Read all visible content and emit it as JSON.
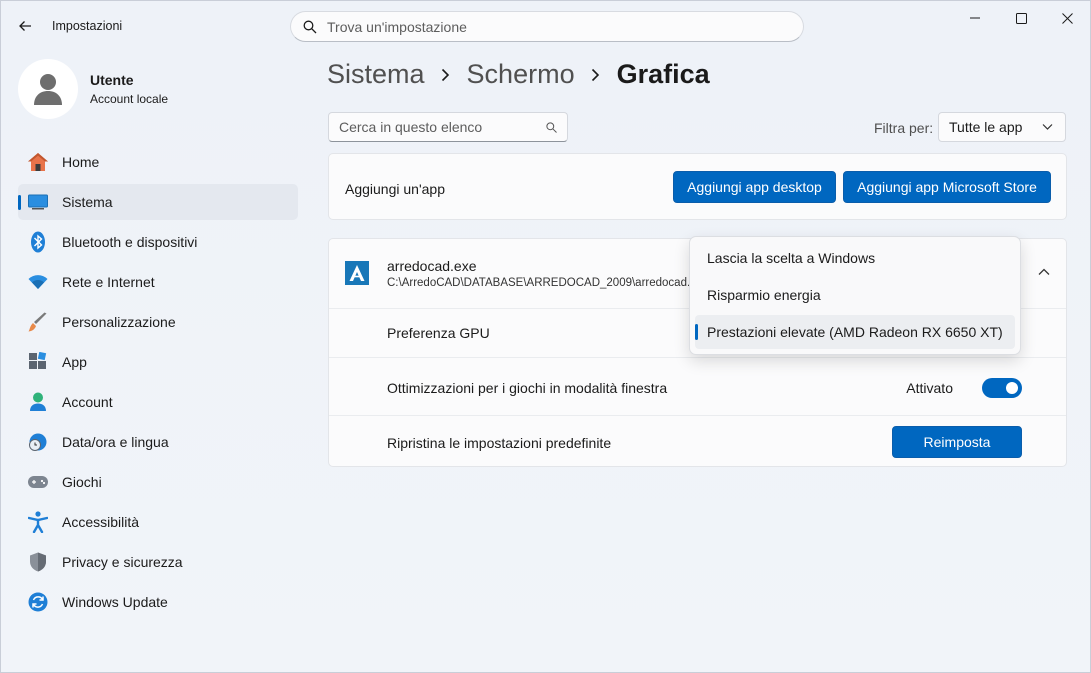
{
  "window": {
    "app_title": "Impostazioni",
    "search_placeholder": "Trova un'impostazione"
  },
  "profile": {
    "name": "Utente",
    "account_type": "Account locale"
  },
  "sidebar": {
    "items": [
      {
        "label": "Home",
        "icon": "home-icon"
      },
      {
        "label": "Sistema",
        "icon": "system-icon",
        "active": true
      },
      {
        "label": "Bluetooth e dispositivi",
        "icon": "bluetooth-icon"
      },
      {
        "label": "Rete e Internet",
        "icon": "wifi-icon"
      },
      {
        "label": "Personalizzazione",
        "icon": "brush-icon"
      },
      {
        "label": "App",
        "icon": "apps-icon"
      },
      {
        "label": "Account",
        "icon": "account-icon"
      },
      {
        "label": "Data/ora e lingua",
        "icon": "clock-globe-icon"
      },
      {
        "label": "Giochi",
        "icon": "gamepad-icon"
      },
      {
        "label": "Accessibilità",
        "icon": "accessibility-icon"
      },
      {
        "label": "Privacy e sicurezza",
        "icon": "shield-icon"
      },
      {
        "label": "Windows Update",
        "icon": "update-icon"
      }
    ]
  },
  "breadcrumb": {
    "items": [
      "Sistema",
      "Schermo",
      "Grafica"
    ]
  },
  "list_controls": {
    "search_placeholder": "Cerca in questo elenco",
    "filter_label": "Filtra per:",
    "filter_value": "Tutte le app"
  },
  "add_app": {
    "label": "Aggiungi un'app",
    "desktop_button": "Aggiungi app desktop",
    "store_button": "Aggiungi app Microsoft Store"
  },
  "app_entry": {
    "name": "arredocad.exe",
    "path": "C:\\ArredoCAD\\DATABASE\\ARREDOCAD_2009\\arredocad.exe",
    "gpu_pref_label": "Preferenza GPU",
    "windowed_opt_label": "Ottimizzazioni per i giochi in modalità finestra",
    "windowed_opt_state": "Attivato",
    "reset_label": "Ripristina le impostazioni predefinite",
    "reset_button": "Reimposta"
  },
  "gpu_dropdown": {
    "options": [
      "Lascia la scelta a Windows",
      "Risparmio energia",
      "Prestazioni elevate (AMD Radeon RX 6650 XT)"
    ],
    "selected_index": 2
  },
  "colors": {
    "accent": "#0067c0"
  }
}
